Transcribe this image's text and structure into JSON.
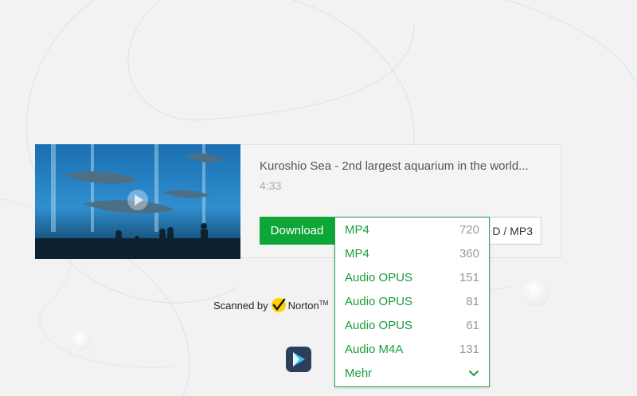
{
  "video": {
    "title": "Kuroshio Sea - 2nd largest aquarium in the world...",
    "duration": "4:33",
    "thumbnail_alt": "Aquarium with whale sharks"
  },
  "buttons": {
    "download_label": "Download",
    "mp3_label": "D / MP3"
  },
  "formats": [
    {
      "format": "MP4",
      "quality": "720"
    },
    {
      "format": "MP4",
      "quality": "360"
    },
    {
      "format": "Audio OPUS",
      "quality": "151"
    },
    {
      "format": "Audio OPUS",
      "quality": "81"
    },
    {
      "format": "Audio OPUS",
      "quality": "61"
    },
    {
      "format": "Audio M4A",
      "quality": "131"
    }
  ],
  "more_label": "Mehr",
  "security": {
    "scanned_by": "Scanned by",
    "brand": "Norton",
    "tm": "TM"
  },
  "colors": {
    "accent": "#0ea737",
    "link_green": "#1c9c3c",
    "background": "#f2f2f2"
  }
}
